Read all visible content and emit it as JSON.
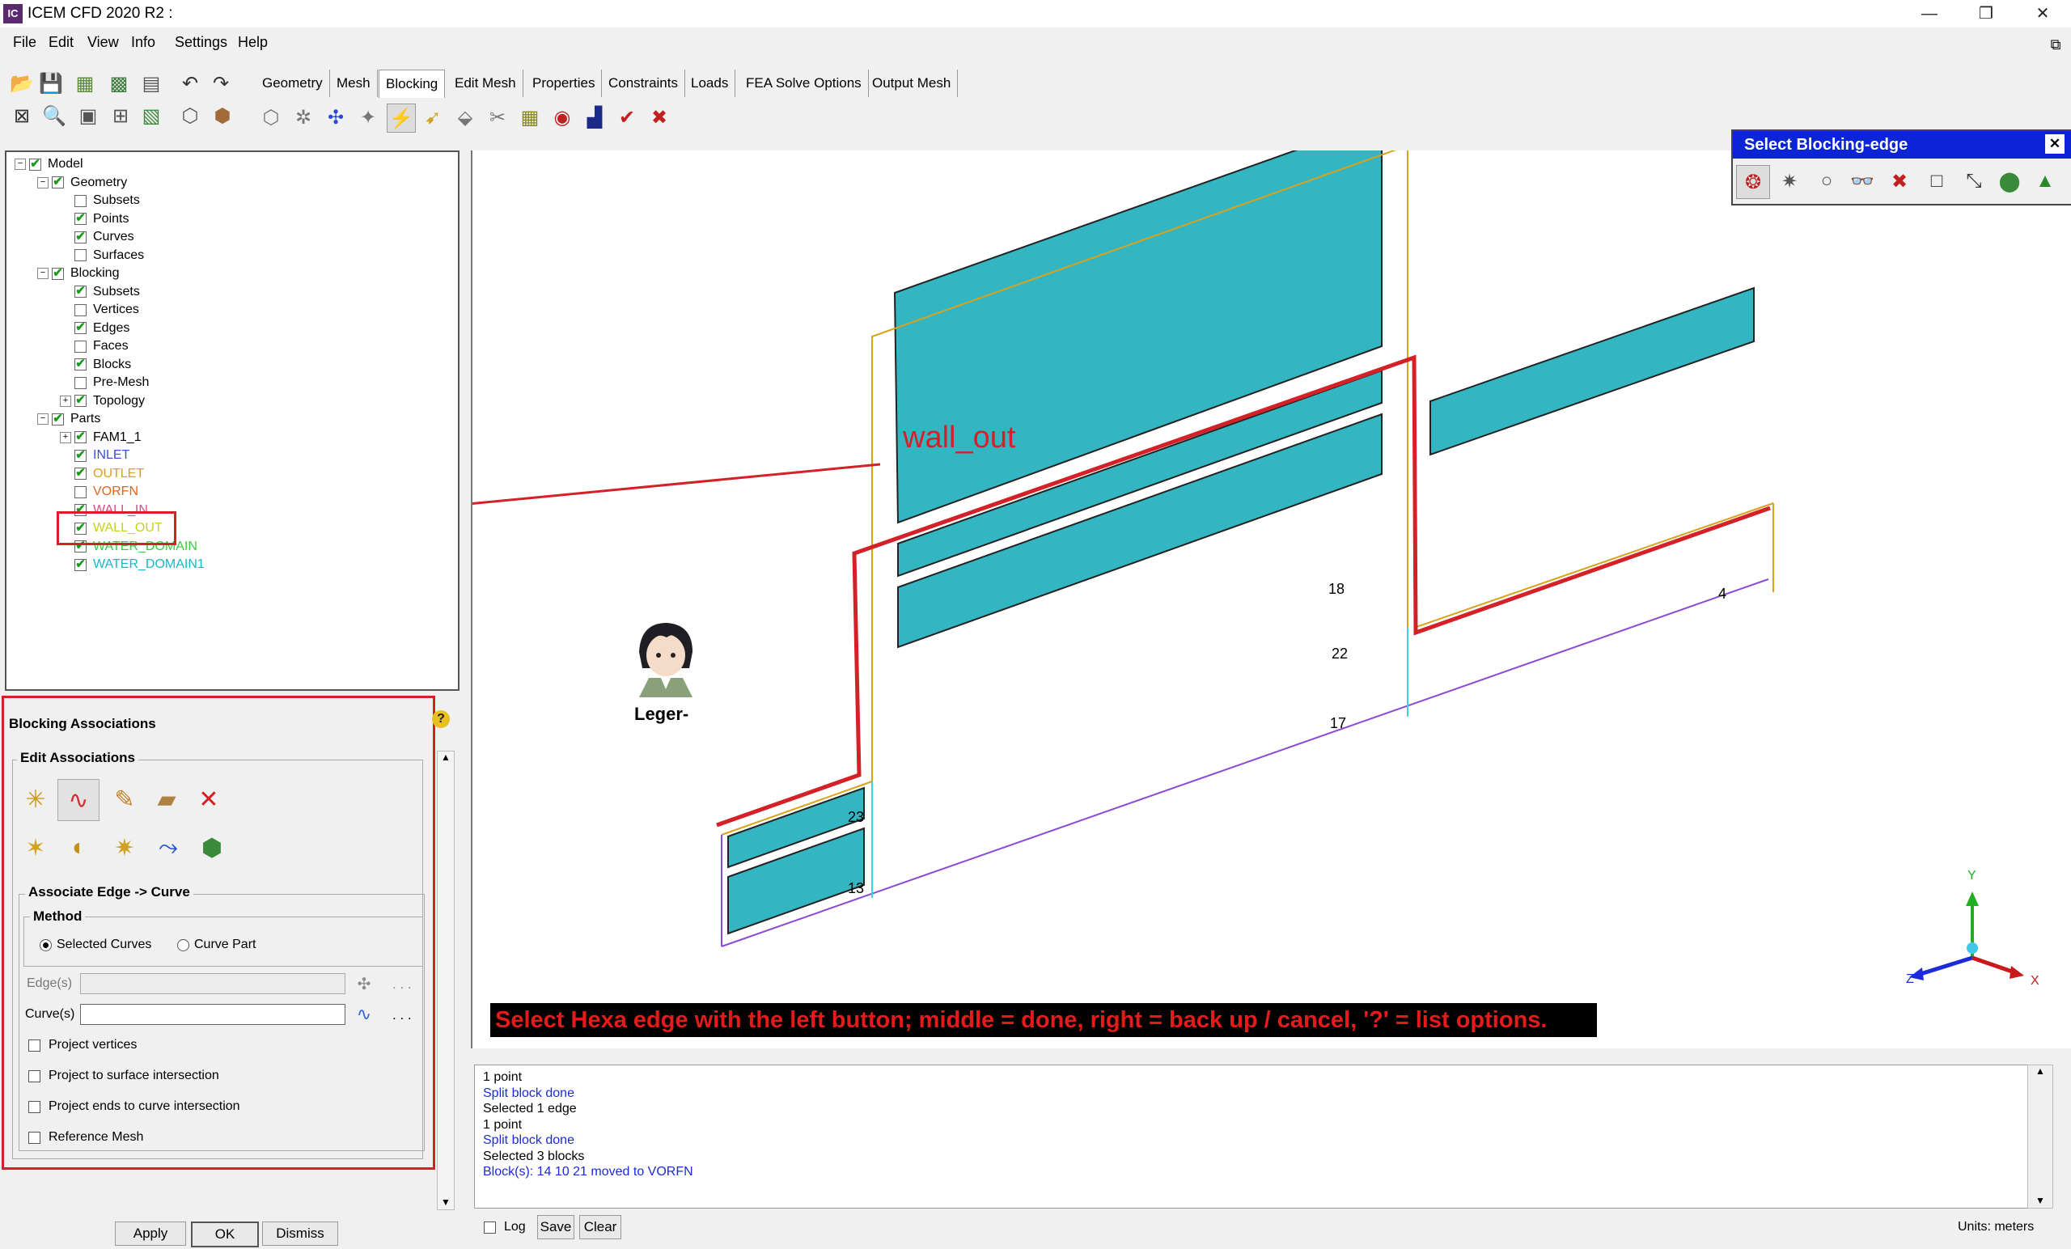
{
  "window": {
    "title": "ICEM CFD 2020 R2 :",
    "app_icon": "IC",
    "controls": [
      "—",
      "❐",
      "✕"
    ]
  },
  "menu": [
    "File",
    "Edit",
    "View",
    "Info",
    "Settings",
    "Help"
  ],
  "tabs": [
    "Geometry",
    "Mesh",
    "Blocking",
    "Edit Mesh",
    "Properties",
    "Constraints",
    "Loads",
    "FEA Solve Options",
    "Output Mesh"
  ],
  "active_tab": "Blocking",
  "tree": [
    {
      "label": "Model",
      "level": 0,
      "expander": "−",
      "checked": true,
      "color": "#000000"
    },
    {
      "label": "Geometry",
      "level": 1,
      "expander": "−",
      "checked": true,
      "color": "#000000"
    },
    {
      "label": "Subsets",
      "level": 2,
      "checked": false,
      "color": "#000000"
    },
    {
      "label": "Points",
      "level": 2,
      "checked": true,
      "color": "#000000"
    },
    {
      "label": "Curves",
      "level": 2,
      "checked": true,
      "color": "#000000"
    },
    {
      "label": "Surfaces",
      "level": 2,
      "checked": false,
      "color": "#000000"
    },
    {
      "label": "Blocking",
      "level": 1,
      "expander": "−",
      "checked": true,
      "color": "#000000"
    },
    {
      "label": "Subsets",
      "level": 2,
      "checked": true,
      "color": "#000000"
    },
    {
      "label": "Vertices",
      "level": 2,
      "checked": false,
      "color": "#000000"
    },
    {
      "label": "Edges",
      "level": 2,
      "checked": true,
      "color": "#000000"
    },
    {
      "label": "Faces",
      "level": 2,
      "checked": false,
      "color": "#000000"
    },
    {
      "label": "Blocks",
      "level": 2,
      "checked": true,
      "color": "#000000"
    },
    {
      "label": "Pre-Mesh",
      "level": 2,
      "checked": false,
      "color": "#000000"
    },
    {
      "label": "Topology",
      "level": 2,
      "expander": "+",
      "checked": true,
      "color": "#000000"
    },
    {
      "label": "Parts",
      "level": 1,
      "expander": "−",
      "checked": true,
      "color": "#000000"
    },
    {
      "label": "FAM1_1",
      "level": 2,
      "expander": "+",
      "checked": true,
      "color": "#000000"
    },
    {
      "label": "INLET",
      "level": 2,
      "checked": true,
      "color": "#3b4fd6"
    },
    {
      "label": "OUTLET",
      "level": 2,
      "checked": true,
      "color": "#d8a21a"
    },
    {
      "label": "VORFN",
      "level": 2,
      "checked": false,
      "color": "#e0641e"
    },
    {
      "label": "WALL_IN",
      "level": 2,
      "checked": true,
      "color": "#d84a8c"
    },
    {
      "label": "WALL_OUT",
      "level": 2,
      "checked": true,
      "color": "#c7d21a"
    },
    {
      "label": "WATER_DOMAIN",
      "level": 2,
      "checked": true,
      "color": "#3ccc3c"
    },
    {
      "label": "WATER_DOMAIN1",
      "level": 2,
      "checked": true,
      "color": "#18b8c8"
    }
  ],
  "assoc": {
    "title": "Blocking Associations",
    "edit_group": "Edit Associations",
    "sub_group": "Associate Edge -> Curve",
    "method_group": "Method",
    "method_options": [
      "Selected Curves",
      "Curve Part"
    ],
    "method_selected": 0,
    "edges_label": "Edge(s)",
    "curves_label": "Curve(s)",
    "ellipsis": ". . .",
    "checkboxes": [
      "Project vertices",
      "Project to surface intersection",
      "Project ends to curve intersection",
      "Reference Mesh"
    ],
    "buttons": {
      "apply": "Apply",
      "ok": "OK",
      "dismiss": "Dismiss"
    }
  },
  "viewport": {
    "annotation": "wall_out",
    "avatar_label": "Leger-",
    "block_numbers": [
      "18",
      "22",
      "17",
      "4",
      "23",
      "13"
    ],
    "axes": {
      "y": "Y",
      "z": "Z",
      "x": "X"
    },
    "status_message": "Select Hexa edge with the left button; middle = done, right = back up / cancel, '?' = list options."
  },
  "select_panel": {
    "title": "Select Blocking-edge",
    "close": "✕"
  },
  "log": {
    "lines": [
      {
        "text": "1 point",
        "color": "#000000"
      },
      {
        "text": "Split block done",
        "color": "#1a2adc"
      },
      {
        "text": "Selected 1 edge",
        "color": "#000000"
      },
      {
        "text": "1 point",
        "color": "#000000"
      },
      {
        "text": "Split block done",
        "color": "#1a2adc"
      },
      {
        "text": "Selected 3 blocks",
        "color": "#000000"
      },
      {
        "text": "Block(s): 14 10 21 moved to VORFN",
        "color": "#1a2adc"
      }
    ],
    "log_label": "Log",
    "save": "Save",
    "clear": "Clear"
  },
  "units": "Units: meters",
  "colors": {
    "accent_red": "#d42027",
    "block_fill": "#34b6c2",
    "select_title": "#0a24d6"
  }
}
